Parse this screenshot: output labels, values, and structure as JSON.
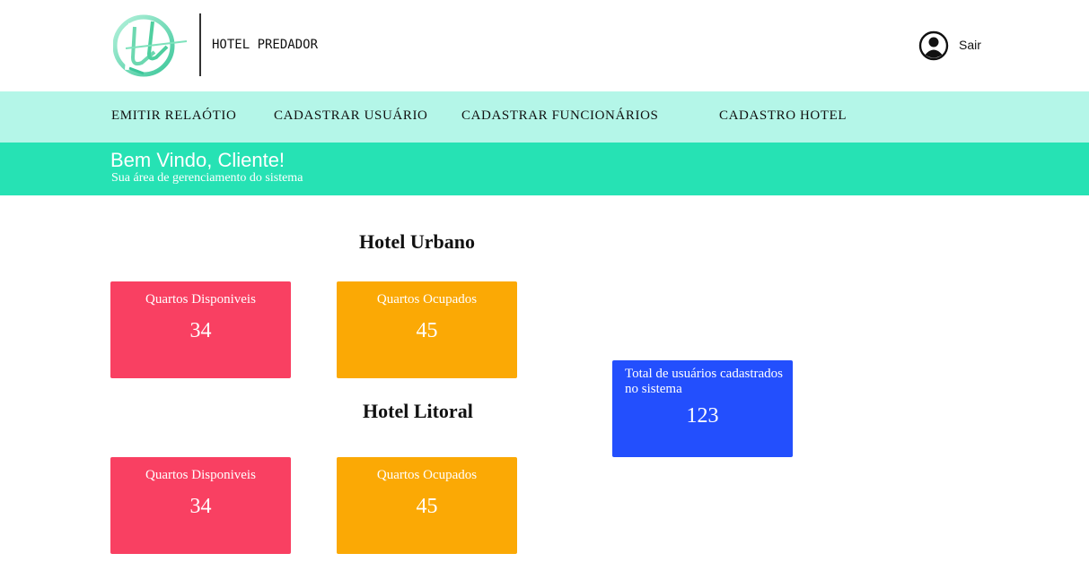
{
  "header": {
    "brand_name": "HOTEL PREDADOR",
    "logout_label": "Sair"
  },
  "nav": {
    "items": [
      {
        "label": "EMITIR RELAÓTIO"
      },
      {
        "label": "CADASTRAR USUÁRIO"
      },
      {
        "label": "CADASTRAR FUNCIONÁRIOS"
      },
      {
        "label": "CADASTRO HOTEL"
      }
    ]
  },
  "welcome": {
    "title": "Bem Vindo, Cliente!",
    "subtitle": "Sua área de gerenciamento do sistema"
  },
  "hotels": [
    {
      "name": "Hotel Urbano",
      "available": {
        "label": "Quartos Disponiveis",
        "value": "34"
      },
      "occupied": {
        "label": "Quartos Ocupados",
        "value": "45"
      }
    },
    {
      "name": "Hotel Litoral",
      "available": {
        "label": "Quartos Disponiveis",
        "value": "34"
      },
      "occupied": {
        "label": "Quartos Ocupados",
        "value": "45"
      }
    }
  ],
  "total_users": {
    "label": "Total de usuários cadastrados no sistema",
    "value": "123"
  },
  "colors": {
    "nav_bg": "#b4f6e8",
    "banner_bg": "#26e2b4",
    "available_card": "#f94062",
    "occupied_card": "#fba905",
    "total_card": "#234ffd"
  }
}
